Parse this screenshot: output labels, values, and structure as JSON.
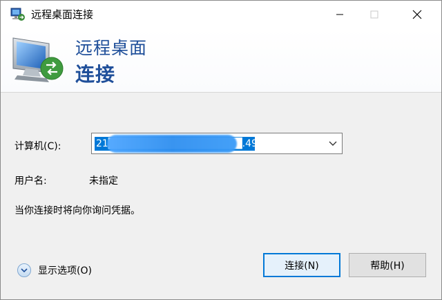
{
  "window": {
    "title": "远程桌面连接",
    "controls": {
      "minimize": "minimize",
      "maximize": "maximize",
      "close": "close"
    }
  },
  "banner": {
    "line1": "远程桌面",
    "line2": "连接"
  },
  "form": {
    "computer_label": "计算机(C):",
    "computer_value": "21██████████████████.494",
    "username_label": "用户名:",
    "username_value": "未指定",
    "credential_note": "当你连接时将向你询问凭据。"
  },
  "footer": {
    "show_options_label": "显示选项(O)",
    "connect_button": "连接(N)",
    "help_button": "帮助(H)"
  },
  "colors": {
    "accent": "#0078d7",
    "banner_text": "#1f4f9a"
  }
}
